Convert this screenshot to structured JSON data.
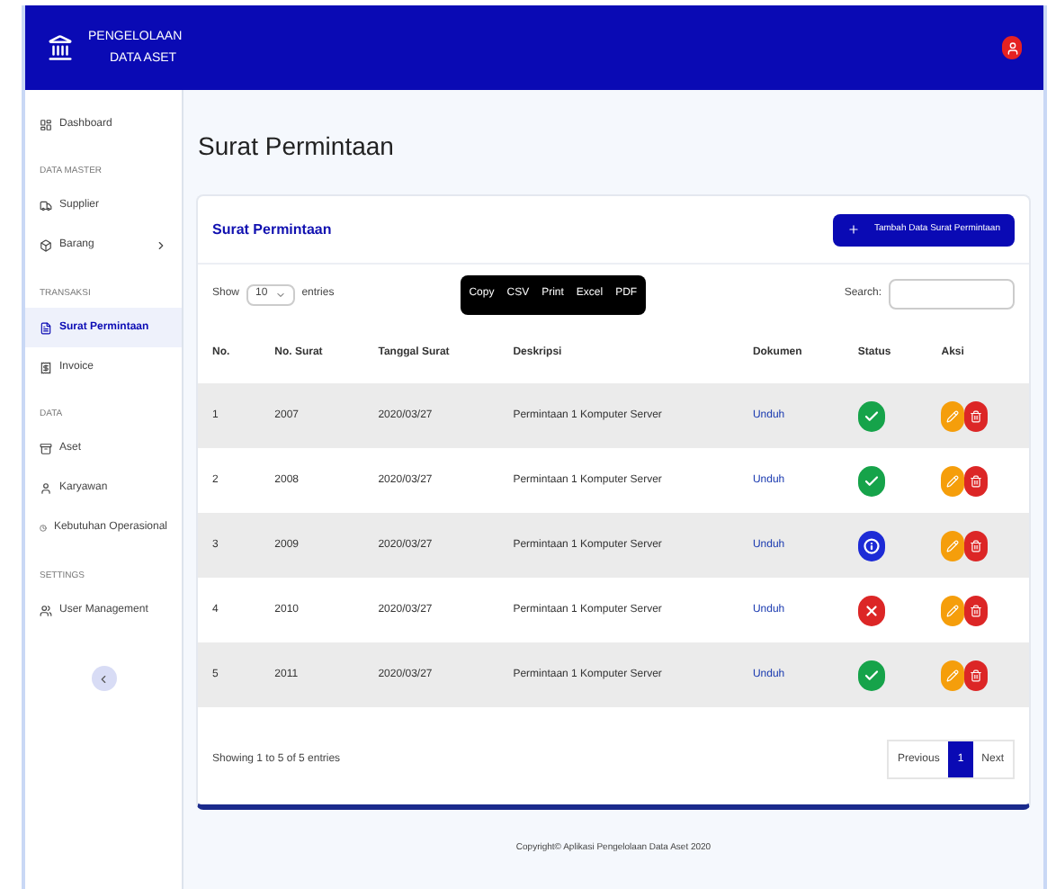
{
  "app": {
    "title_lines": [
      "PENGELOLAAN",
      "DATA ASET"
    ]
  },
  "sidebar": {
    "items": [
      {
        "kind": "link",
        "label": "Dashboard",
        "selected": false
      },
      {
        "kind": "heading",
        "label": "DATA MASTER"
      },
      {
        "kind": "link",
        "label": "Supplier",
        "selected": false
      },
      {
        "kind": "link",
        "label": "Barang",
        "selected": false,
        "expandable": true
      },
      {
        "kind": "heading",
        "label": "TRANSAKSI"
      },
      {
        "kind": "link",
        "label": "Surat Permintaan",
        "selected": true
      },
      {
        "kind": "link",
        "label": "Invoice",
        "selected": false
      },
      {
        "kind": "heading",
        "label": "DATA"
      },
      {
        "kind": "link",
        "label": "Aset",
        "selected": false
      },
      {
        "kind": "link",
        "label": "Karyawan",
        "selected": false
      },
      {
        "kind": "link",
        "label": "Kebutuhan Operasional",
        "selected": false
      },
      {
        "kind": "heading",
        "label": "SETTINGS"
      },
      {
        "kind": "link",
        "label": "User Management",
        "selected": false
      }
    ]
  },
  "page_title": "Surat Permintaan",
  "card": {
    "title": "Surat Permintaan",
    "add_button": "Tambah Data Surat Permintaan",
    "show_label": "Show",
    "show_value": "10",
    "entries_label": "entries",
    "export_buttons": [
      "Copy",
      "CSV",
      "Print",
      "Excel",
      "PDF"
    ],
    "search_label": "Search:",
    "table": {
      "columns": [
        "No.",
        "No. Surat",
        "Tanggal Surat",
        "Deskripsi",
        "Dokumen",
        "Status",
        "Aksi"
      ],
      "rows": [
        {
          "no": "1",
          "number": "2007",
          "date": "2020/03/27",
          "description": "Permintaan 1 Komputer Server",
          "document": "Unduh",
          "status": {
            "kind": "approved",
            "color": "#16a34a"
          }
        },
        {
          "no": "2",
          "number": "2008",
          "date": "2020/03/27",
          "description": "Permintaan 1 Komputer Server",
          "document": "Unduh",
          "status": {
            "kind": "approved",
            "color": "#16a34a"
          }
        },
        {
          "no": "3",
          "number": "2009",
          "date": "2020/03/27",
          "description": "Permintaan 1 Komputer Server",
          "document": "Unduh",
          "status": {
            "kind": "pending",
            "color": "#1d2bd6"
          }
        },
        {
          "no": "4",
          "number": "2010",
          "date": "2020/03/27",
          "description": "Permintaan 1 Komputer Server",
          "document": "Unduh",
          "status": {
            "kind": "rejected",
            "color": "#dc2626"
          }
        },
        {
          "no": "5",
          "number": "2011",
          "date": "2020/03/27",
          "description": "Permintaan 1 Komputer Server",
          "document": "Unduh",
          "status": {
            "kind": "approved",
            "color": "#16a34a"
          }
        }
      ]
    },
    "info": "Showing 1 to 5 of 5 entries",
    "pagination": [
      {
        "label": "Previous",
        "selected": false
      },
      {
        "label": "1",
        "selected": true
      },
      {
        "label": "Next",
        "selected": false
      }
    ]
  },
  "footer": "Copyright© Aplikasi Pengelolaan Data Aset 2020"
}
